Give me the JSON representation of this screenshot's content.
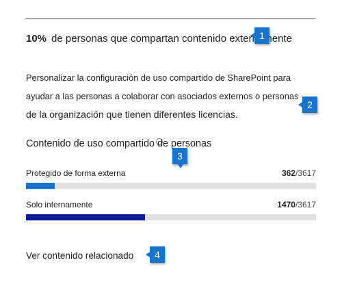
{
  "headline": {
    "percent": "10%",
    "text": "de personas que compartan contenido externamente"
  },
  "description": {
    "line1": "Personalizar la configuración de uso compartido de SharePoint para",
    "line2": "ayudar a las personas a colaborar con asociados externos o personas",
    "line3": "de la organización que tienen diferentes licencias."
  },
  "section_title": "Contenido de uso compartido de personas",
  "metrics": [
    {
      "label": "Protegido de forma externa",
      "count": "362",
      "total": "/3617",
      "fraction": 0.1,
      "color": "#1a73c8"
    },
    {
      "label": "Solo internamente",
      "count": "1470",
      "total": "/3617",
      "fraction": 0.41,
      "color": "#0b1f8f"
    }
  ],
  "related_link": "Ver contenido relacionado",
  "callouts": [
    "1",
    "2",
    "3",
    "4"
  ],
  "colors": {
    "callout": "#1a73c8",
    "track": "#e1e1e1"
  }
}
